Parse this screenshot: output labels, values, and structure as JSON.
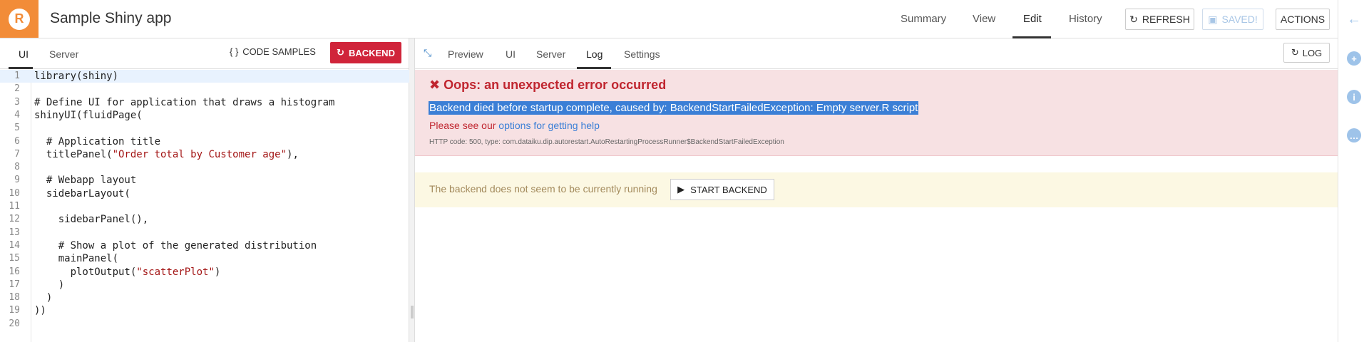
{
  "header": {
    "app_title": "Sample Shiny app",
    "nav": [
      "Summary",
      "View",
      "Edit",
      "History"
    ],
    "active_nav": "Edit",
    "refresh_label": "REFRESH",
    "saved_label": "SAVED!",
    "actions_label": "ACTIONS",
    "accent": "#f28c38"
  },
  "left": {
    "tabs": [
      "UI",
      "Server"
    ],
    "active_tab": "UI",
    "code_samples_label": "CODE SAMPLES",
    "backend_label": "BACKEND",
    "code": [
      {
        "n": "1",
        "text": "library(shiny)",
        "kind": "plain"
      },
      {
        "n": "2",
        "text": "",
        "kind": "plain"
      },
      {
        "n": "3",
        "text": "# Define UI for application that draws a histogram",
        "kind": "comment"
      },
      {
        "n": "4",
        "text": "shinyUI(fluidPage(",
        "kind": "plain"
      },
      {
        "n": "5",
        "text": "",
        "kind": "plain"
      },
      {
        "n": "6",
        "text": "  # Application title",
        "kind": "comment"
      },
      {
        "n": "7",
        "text": "  titlePanel(",
        "kind": "plain",
        "str": "\"Order total by Customer age\"",
        "after": "),"
      },
      {
        "n": "8",
        "text": "",
        "kind": "plain"
      },
      {
        "n": "9",
        "text": "  # Webapp layout",
        "kind": "comment"
      },
      {
        "n": "10",
        "text": "  sidebarLayout(",
        "kind": "plain"
      },
      {
        "n": "11",
        "text": "",
        "kind": "plain"
      },
      {
        "n": "12",
        "text": "    sidebarPanel(),",
        "kind": "plain"
      },
      {
        "n": "13",
        "text": "",
        "kind": "plain"
      },
      {
        "n": "14",
        "text": "    # Show a plot of the generated distribution",
        "kind": "comment"
      },
      {
        "n": "15",
        "text": "    mainPanel(",
        "kind": "plain"
      },
      {
        "n": "16",
        "text": "      plotOutput(",
        "kind": "plain",
        "str": "\"scatterPlot\"",
        "after": ")"
      },
      {
        "n": "17",
        "text": "    )",
        "kind": "plain"
      },
      {
        "n": "18",
        "text": "  )",
        "kind": "plain"
      },
      {
        "n": "19",
        "text": "))",
        "kind": "plain"
      },
      {
        "n": "20",
        "text": "",
        "kind": "plain"
      }
    ]
  },
  "right": {
    "tabs": [
      "Preview",
      "UI",
      "Server",
      "Log",
      "Settings"
    ],
    "active_tab": "Log",
    "log_button_label": "LOG",
    "error": {
      "title": "Oops: an unexpected error occurred",
      "message": "Backend died before startup complete, caused by: BackendStartFailedException: Empty server.R script",
      "help_prefix": "Please see our ",
      "help_link": "options for getting help",
      "code_line": "HTTP code: 500, type: com.dataiku.dip.autorestart.AutoRestartingProcessRunner$BackendStartFailedException"
    },
    "warning": {
      "text": "The backend does not seem to be currently running",
      "start_label": "START BACKEND"
    }
  }
}
